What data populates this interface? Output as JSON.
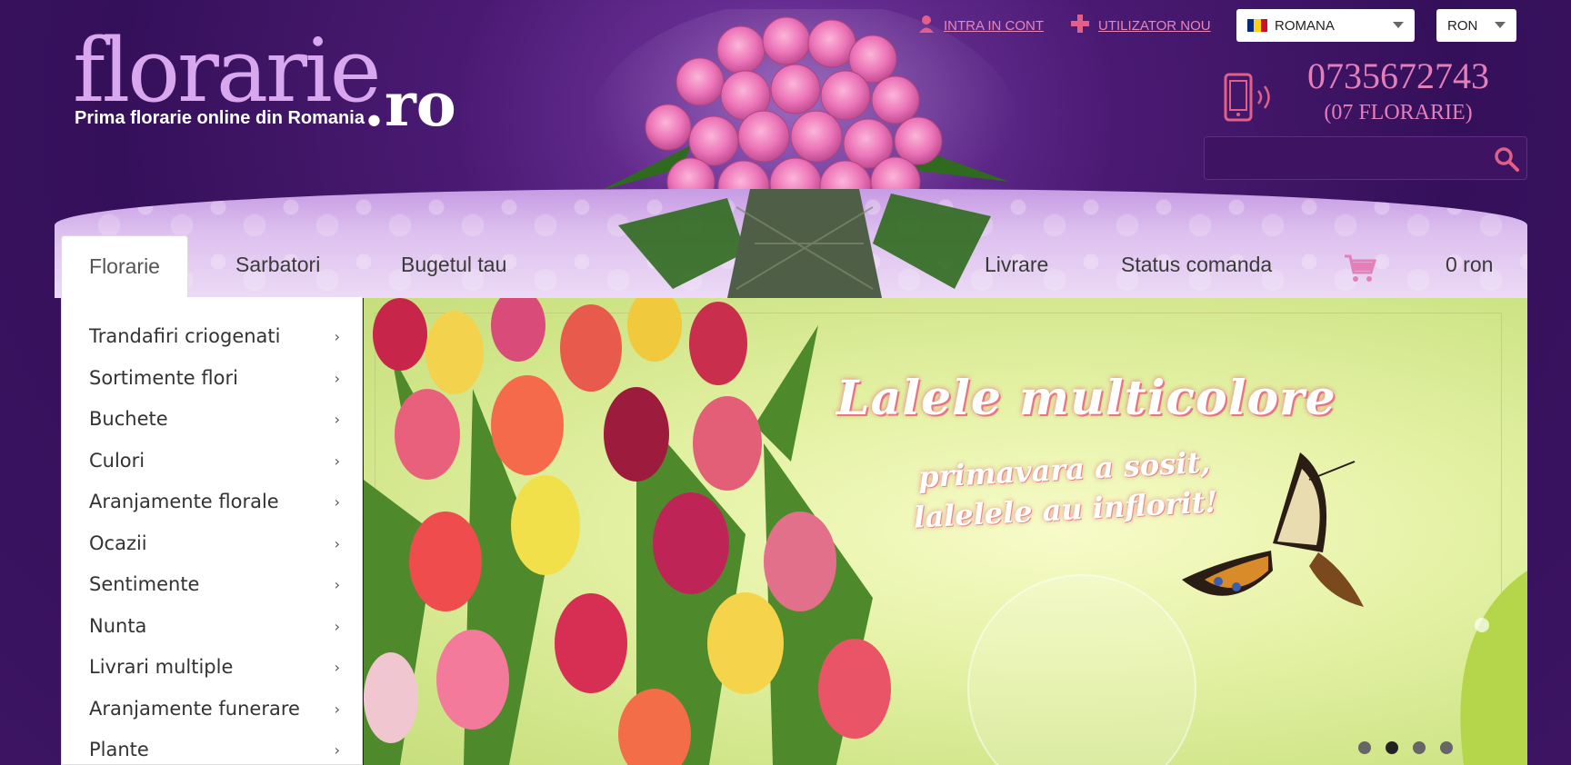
{
  "brand": {
    "logo_text": "florarie",
    "logo_tld": ".ro",
    "tagline": "Prima florarie online din Romania"
  },
  "top_links": {
    "login": "INTRA IN CONT",
    "register": "UTILIZATOR NOU"
  },
  "language_select": {
    "selected": "ROMANA",
    "flag_colors": [
      "#002b7f",
      "#fcd116",
      "#ce1126"
    ]
  },
  "currency_select": {
    "selected": "RON"
  },
  "contact": {
    "phone": "0735672743",
    "phone_alt": "(07 FLORARIE)"
  },
  "search": {
    "placeholder": "",
    "value": ""
  },
  "nav": {
    "active": "Florarie",
    "items": [
      "Sarbatori",
      "Bugetul tau",
      "Livrare",
      "Status comanda"
    ],
    "cart_total": "0 ron"
  },
  "sidebar": {
    "items": [
      "Trandafiri criogenati",
      "Sortimente flori",
      "Buchete",
      "Culori",
      "Aranjamente florale",
      "Ocazii",
      "Sentimente",
      "Nunta",
      "Livrari multiple",
      "Aranjamente funerare",
      "Plante"
    ]
  },
  "banner": {
    "title": "Lalele multicolore",
    "subtitle_line1": "primavara a sosit,",
    "subtitle_line2": "lalelele au inflorit!",
    "slide_count": 4,
    "active_slide": 2
  },
  "colors": {
    "background": "#3c1462",
    "accent_pink": "#e57fb9",
    "logo_lilac": "#d8a7ee"
  }
}
